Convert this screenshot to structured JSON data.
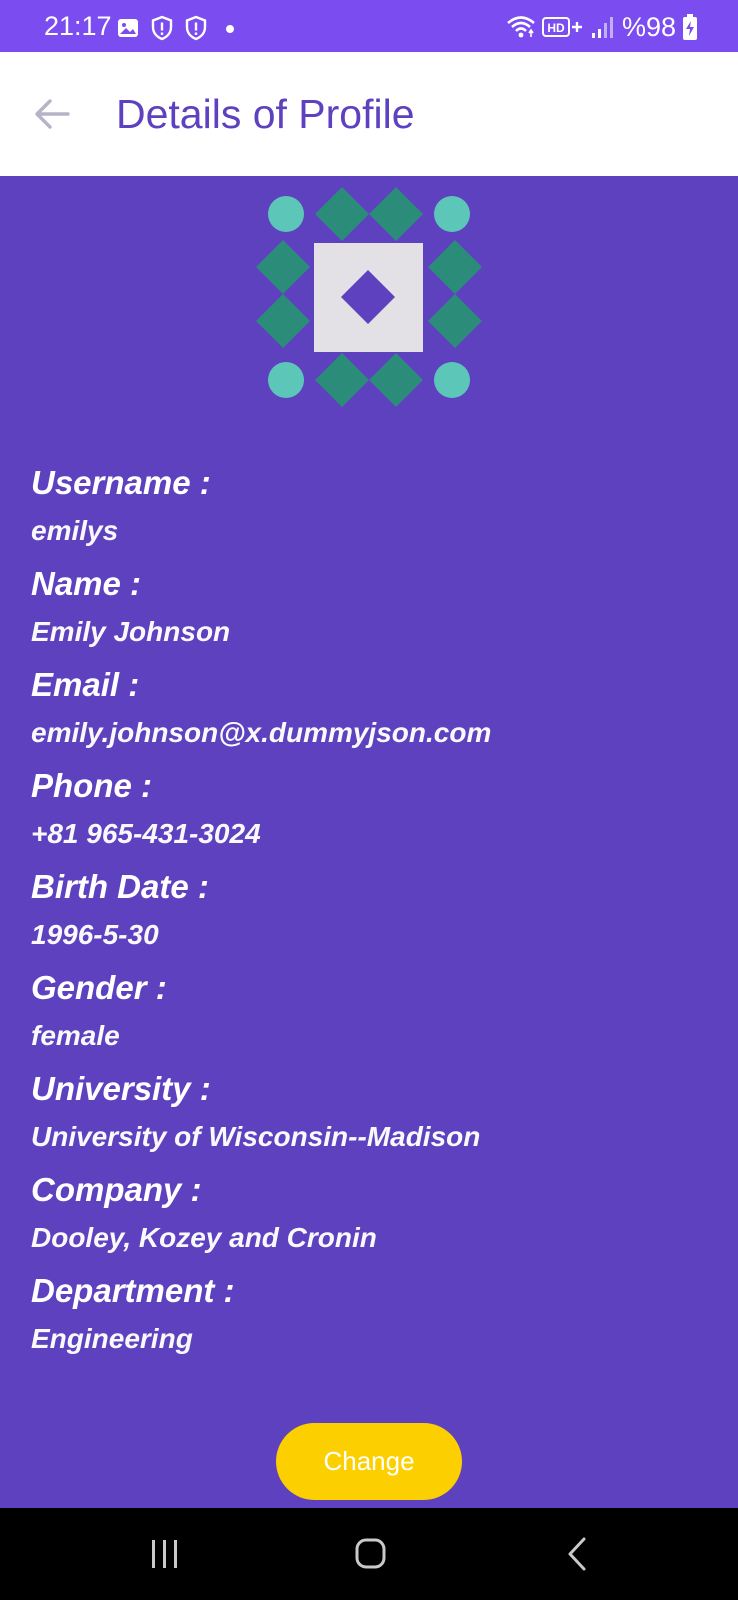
{
  "status_bar": {
    "time": "21:17",
    "battery": "%98",
    "left_icons": [
      "gallery-icon",
      "shield-icon",
      "shield-icon",
      "dot-icon"
    ],
    "right_icons": [
      "wifi-icon",
      "hd-plus-icon",
      "signal-icon",
      "battery-charging-icon"
    ],
    "background_color": "#7b4df1"
  },
  "app_bar": {
    "title": "Details of Profile",
    "back_icon": "arrow-back-icon"
  },
  "avatar": {
    "icon": "identicon-avatar",
    "colors": {
      "circle": "#5cc7b8",
      "diamond": "#2b8c7a",
      "center": "#e3e1e5",
      "inner_diamond": "#5e41be"
    }
  },
  "profile": {
    "fields": [
      {
        "label": "Username :",
        "value": "emilys"
      },
      {
        "label": "Name :",
        "value": "Emily Johnson"
      },
      {
        "label": "Email :",
        "value": "emily.johnson@x.dummyjson.com"
      },
      {
        "label": "Phone :",
        "value": "+81 965-431-3024"
      },
      {
        "label": "Birth Date :",
        "value": "1996-5-30"
      },
      {
        "label": "Gender :",
        "value": "female"
      },
      {
        "label": "University :",
        "value": "University of Wisconsin--Madison"
      },
      {
        "label": "Company :",
        "value": "Dooley, Kozey and Cronin"
      },
      {
        "label": "Department :",
        "value": "Engineering"
      }
    ]
  },
  "actions": {
    "change_label": "Change",
    "change_color": "#fcd000"
  },
  "nav_bar": {
    "items": [
      "recents-icon",
      "home-icon",
      "back-icon"
    ]
  },
  "theme": {
    "primary": "#5e41be",
    "text_on_primary": "#ffffff"
  }
}
